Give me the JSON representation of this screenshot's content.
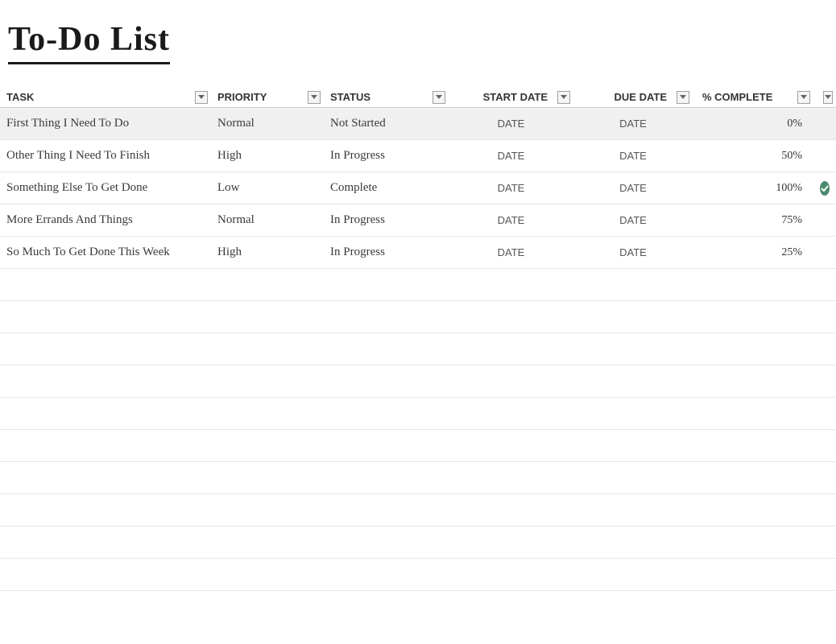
{
  "title": "To-Do List",
  "headers": {
    "task": "TASK",
    "priority": "PRIORITY",
    "status": "STATUS",
    "startDate": "START DATE",
    "dueDate": "DUE DATE",
    "percentComplete": "% COMPLETE"
  },
  "rows": [
    {
      "task": "First Thing I Need To Do",
      "priority": "Normal",
      "status": "Not Started",
      "startDate": "DATE",
      "dueDate": "DATE",
      "percent": 0,
      "percentLabel": "0%",
      "done": false,
      "selected": true
    },
    {
      "task": "Other Thing I Need To Finish",
      "priority": "High",
      "status": "In Progress",
      "startDate": "DATE",
      "dueDate": "DATE",
      "percent": 50,
      "percentLabel": "50%",
      "done": false,
      "selected": false
    },
    {
      "task": "Something Else To Get Done",
      "priority": "Low",
      "status": "Complete",
      "startDate": "DATE",
      "dueDate": "DATE",
      "percent": 100,
      "percentLabel": "100%",
      "done": true,
      "selected": false
    },
    {
      "task": "More Errands And Things",
      "priority": "Normal",
      "status": "In Progress",
      "startDate": "DATE",
      "dueDate": "DATE",
      "percent": 75,
      "percentLabel": "75%",
      "done": false,
      "selected": false
    },
    {
      "task": "So Much To Get Done This Week",
      "priority": "High",
      "status": "In Progress",
      "startDate": "DATE",
      "dueDate": "DATE",
      "percent": 25,
      "percentLabel": "25%",
      "done": false,
      "selected": false
    }
  ],
  "emptyRows": 10,
  "colors": {
    "barFill": "#b9a3b0",
    "doneBadge": "#4a8a6f"
  }
}
